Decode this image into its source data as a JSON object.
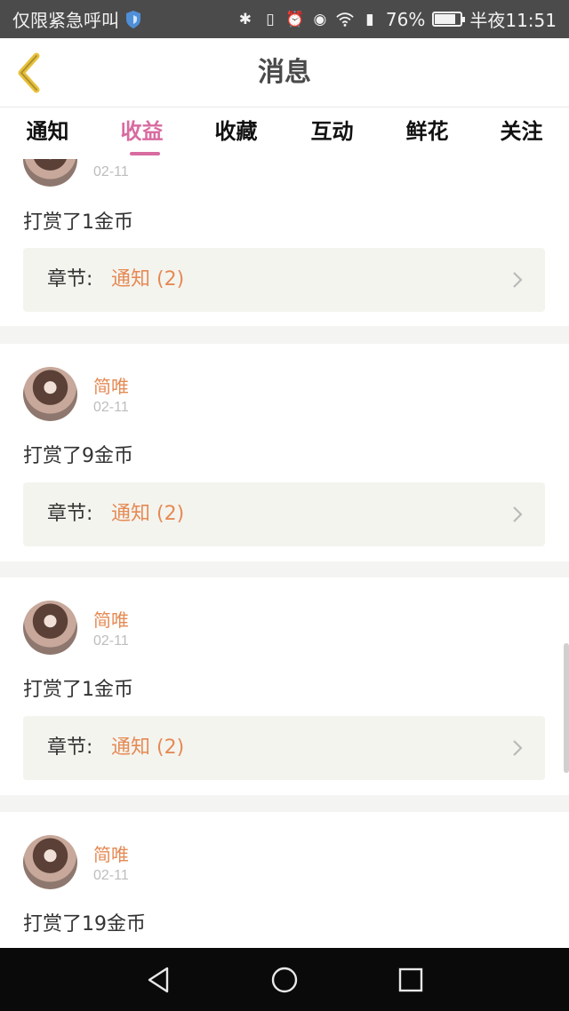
{
  "statusbar": {
    "carrier": "仅限紧急呼叫",
    "battery_level": "76%",
    "battery_fraction": 0.76,
    "time": "半夜11:51",
    "icons": [
      "bluetooth-icon",
      "vibrate-icon",
      "alarm-icon",
      "eye-icon",
      "wifi-icon",
      "alert-sim-icon",
      "battery-icon"
    ]
  },
  "header": {
    "title": "消息",
    "back_icon": "chevron-left-icon"
  },
  "tabs": [
    {
      "label": "通知"
    },
    {
      "label": "收益",
      "active": true
    },
    {
      "label": "收藏"
    },
    {
      "label": "互动"
    },
    {
      "label": "鲜花"
    },
    {
      "label": "关注"
    }
  ],
  "items": [
    {
      "date": "02-11",
      "reward": "打赏了1金币",
      "chapter_label": "章节:",
      "chapter_value": "通知 (2)"
    },
    {
      "user": "简唯",
      "date": "02-11",
      "reward": "打赏了9金币",
      "chapter_label": "章节:",
      "chapter_value": "通知 (2)"
    },
    {
      "user": "简唯",
      "date": "02-11",
      "reward": "打赏了1金币",
      "chapter_label": "章节:",
      "chapter_value": "通知 (2)"
    },
    {
      "user": "简唯",
      "date": "02-11",
      "reward": "打赏了19金币"
    }
  ],
  "colors": {
    "accent": "#d86ba0",
    "username": "#e58a54",
    "back_arrow": "#e8c13a"
  }
}
